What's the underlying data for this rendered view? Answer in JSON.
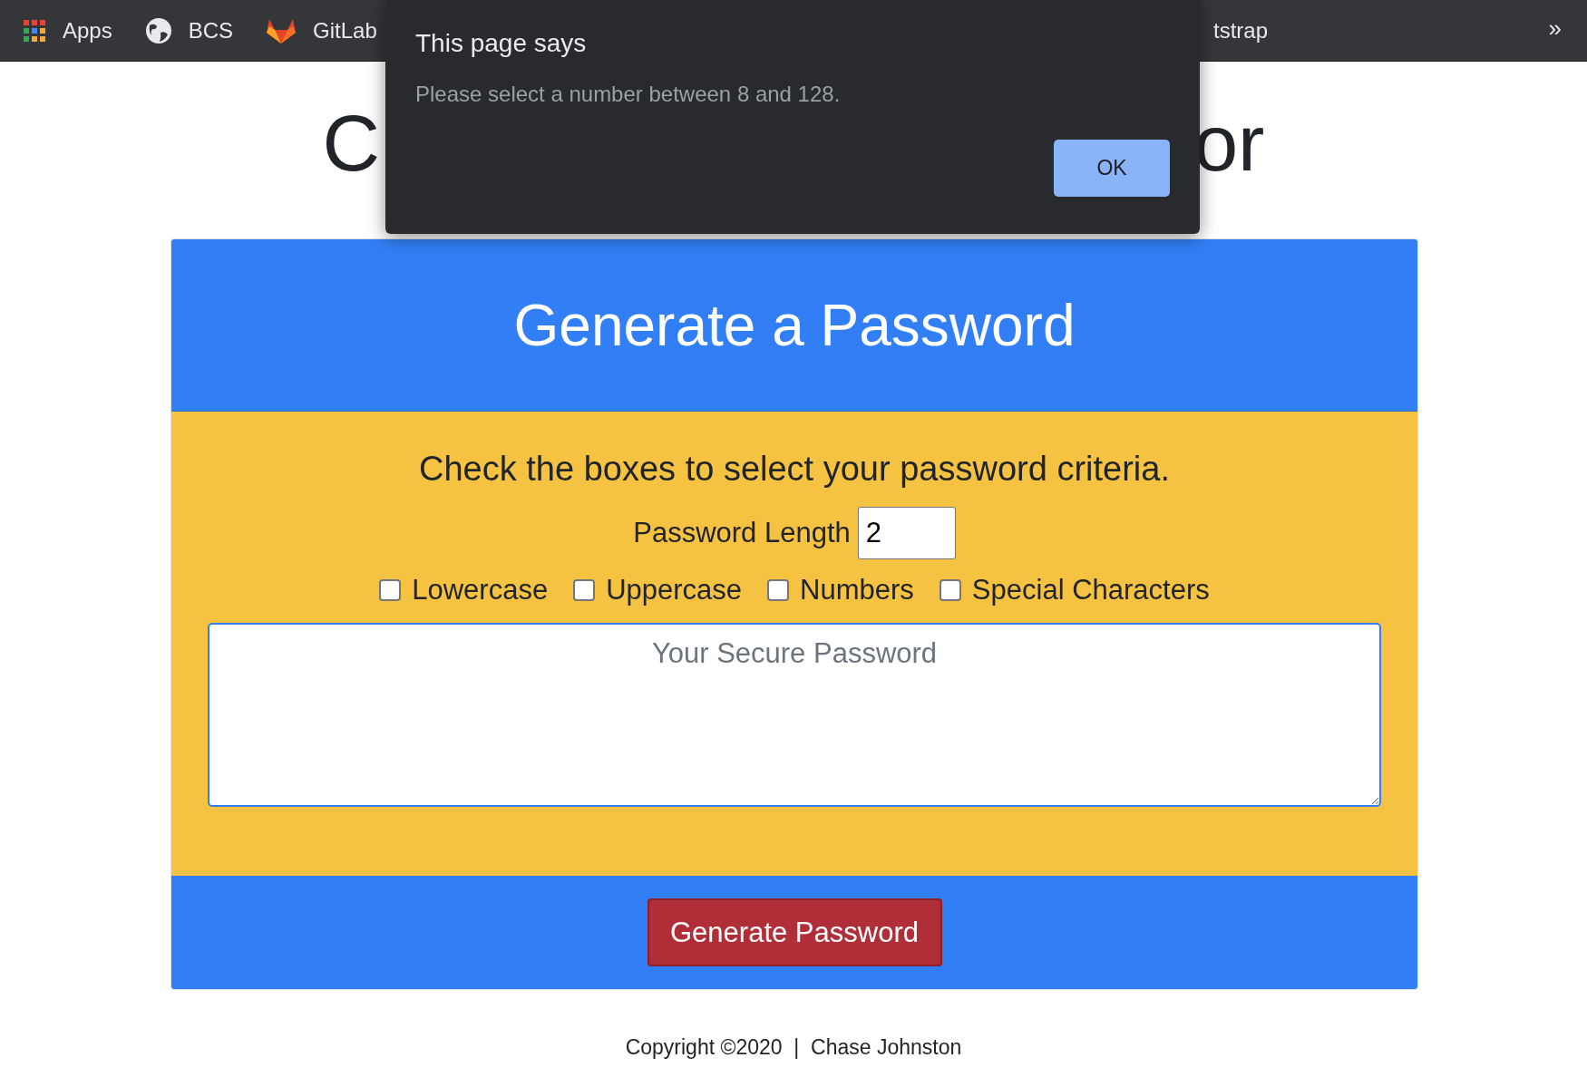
{
  "bookmarks_bar": {
    "items": [
      {
        "kind": "apps",
        "label": "Apps"
      },
      {
        "kind": "globe",
        "label": "BCS"
      },
      {
        "kind": "fox",
        "label": "GitLab"
      }
    ],
    "partial_item": "tstrap",
    "overflow": "»"
  },
  "heading": {
    "left_part": "C",
    "right_part": "or"
  },
  "card": {
    "title": "Generate a Password",
    "instructions": "Check the boxes to select your password criteria.",
    "length_label": "Password Length",
    "length_value": "2",
    "criteria": [
      {
        "label": "Lowercase",
        "checked": false
      },
      {
        "label": "Uppercase",
        "checked": false
      },
      {
        "label": "Numbers",
        "checked": false
      },
      {
        "label": "Special Characters",
        "checked": false
      }
    ],
    "password_placeholder": "Your Secure Password",
    "generate_button": "Generate Password"
  },
  "footer": "Copyright ©2020  |  Chase Johnston",
  "dialog": {
    "title": "This page says",
    "message": "Please select a number between 8 and 128.",
    "button": "OK"
  }
}
